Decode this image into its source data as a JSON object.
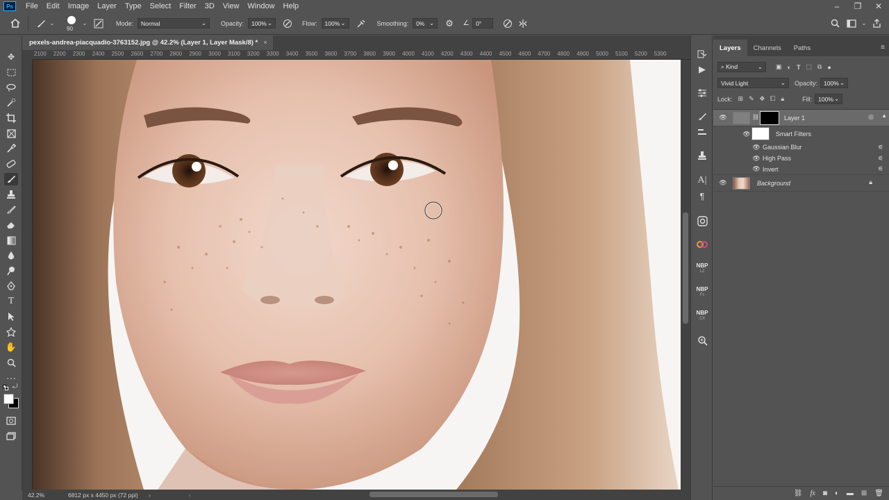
{
  "menubar": {
    "logo": "Ps",
    "items": [
      "File",
      "Edit",
      "Image",
      "Layer",
      "Type",
      "Select",
      "Filter",
      "3D",
      "View",
      "Window",
      "Help"
    ],
    "window_controls": [
      "–",
      "❐",
      "✕"
    ]
  },
  "options": {
    "brush_size": "90",
    "mode_label": "Mode:",
    "mode_value": "Normal",
    "opacity_label": "Opacity:",
    "opacity_value": "100%",
    "flow_label": "Flow:",
    "flow_value": "100%",
    "smoothing_label": "Smoothing:",
    "smoothing_value": "0%",
    "angle_value": "0°"
  },
  "document": {
    "tab_title": "pexels-andrea-piacquadio-3763152.jpg @ 42.2% (Layer 1, Layer Mask/8) *",
    "close_glyph": "×",
    "ruler_ticks": [
      "2100",
      "2200",
      "2300",
      "2400",
      "2500",
      "2600",
      "2700",
      "2800",
      "2900",
      "3000",
      "3100",
      "3200",
      "3300",
      "3400",
      "3500",
      "3600",
      "3700",
      "3800",
      "3900",
      "4000",
      "4100",
      "4200",
      "4300",
      "4400",
      "4500",
      "4600",
      "4700",
      "4800",
      "4900",
      "5000",
      "5100",
      "5200",
      "5300"
    ]
  },
  "status": {
    "zoom": "42.2%",
    "doc_info": "6812 px x 4450 px (72 ppi)"
  },
  "layers_panel": {
    "tabs": [
      "Layers",
      "Channels",
      "Paths"
    ],
    "filter_kind": "Kind",
    "blend_mode": "Vivid Light",
    "opacity_label": "Opacity:",
    "opacity_value": "100%",
    "lock_label": "Lock:",
    "fill_label": "Fill:",
    "fill_value": "100%",
    "layers": {
      "layer1": "Layer 1",
      "smart_filters": "Smart Filters",
      "filter_1": "Gaussian Blur",
      "filter_2": "High Pass",
      "filter_3": "Invert",
      "background": "Background"
    }
  },
  "strip": {
    "nbp1": "NBP",
    "nbp1_sub": "LZ",
    "nbp2": "NBP",
    "nbp2_sub": "Fs",
    "nbp3": "NBP",
    "nbp3_sub": "CX"
  }
}
